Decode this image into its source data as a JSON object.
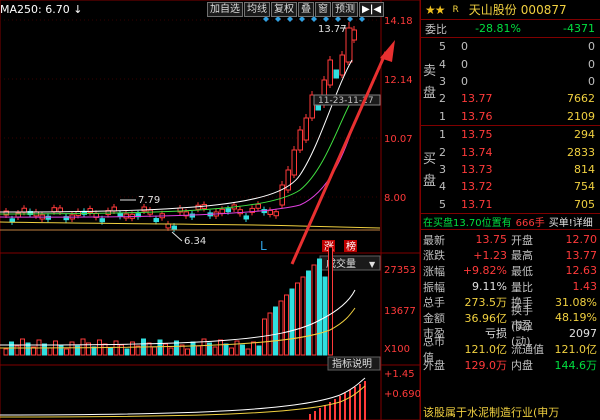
{
  "chart": {
    "ma_label": "MA250: 6.70",
    "ma_arrow": "↓",
    "toolbar": [
      "加自选",
      "均线",
      "复权",
      "叠",
      "窗",
      "预测"
    ],
    "toolbar_nav": "▶|◀",
    "price_ticks": [
      "14.18",
      "12.14",
      "10.07",
      "8.00"
    ],
    "high_label": "13.77",
    "low_label": "6.34",
    "mid_label": "7.79",
    "date_label": "11-23-11-27",
    "marker_L": "L",
    "badge_zhang": "涨",
    "badge_ting": "榜",
    "vol_button": "成交量",
    "vol_ticks": [
      "27353",
      "13677",
      "X100"
    ],
    "indicator_button": "指标说明",
    "macd_ticks": [
      "+1.45",
      "+0.690"
    ],
    "colors": {
      "up": "#ff3a3a",
      "down": "#30e0e0",
      "ma_white": "#ffffff",
      "ma_yellow": "#f0d040",
      "ma_magenta": "#e040e0",
      "ma_green": "#40e040",
      "axis": "#800000"
    }
  },
  "quote": {
    "stars": "★★",
    "r_badge": "R",
    "name": "天山股份",
    "code": "000877",
    "weibi_label": "委比",
    "weibi_pct": "-28.81%",
    "weibi_diff": "-4371",
    "sell_label": [
      "卖",
      "盘"
    ],
    "buy_label": [
      "买",
      "盘"
    ],
    "sell": [
      {
        "idx": "5",
        "price": "0",
        "qty": "0"
      },
      {
        "idx": "4",
        "price": "0",
        "qty": "0"
      },
      {
        "idx": "3",
        "price": "0",
        "qty": "0"
      },
      {
        "idx": "2",
        "price": "13.77",
        "qty": "7662"
      },
      {
        "idx": "1",
        "price": "13.76",
        "qty": "2109"
      }
    ],
    "buy": [
      {
        "idx": "1",
        "price": "13.75",
        "qty": "294"
      },
      {
        "idx": "2",
        "price": "13.74",
        "qty": "2833"
      },
      {
        "idx": "3",
        "price": "13.73",
        "qty": "814"
      },
      {
        "idx": "4",
        "price": "13.72",
        "qty": "754"
      },
      {
        "idx": "5",
        "price": "13.71",
        "qty": "705"
      }
    ],
    "summary_a": "在买盘13.70位置有",
    "summary_b": "666手",
    "summary_c": "买单!详细",
    "stats": [
      {
        "k": "最新",
        "v": "13.75",
        "vc": "red",
        "k2": "开盘",
        "v2": "12.70",
        "v2c": "red"
      },
      {
        "k": "涨跌",
        "v": "+1.23",
        "vc": "red",
        "k2": "最高",
        "v2": "13.77",
        "v2c": "red"
      },
      {
        "k": "涨幅",
        "v": "+9.82%",
        "vc": "red",
        "k2": "最低",
        "v2": "12.63",
        "v2c": "red"
      },
      {
        "k": "振幅",
        "v": "9.11%",
        "vc": "white",
        "k2": "量比",
        "v2": "1.43",
        "v2c": "red"
      },
      {
        "k": "总手",
        "v": "273.5万",
        "vc": "yellow",
        "k2": "换手",
        "v2": "31.08%",
        "v2c": "yellow"
      },
      {
        "k": "金额",
        "v": "36.96亿",
        "vc": "yellow",
        "k2": "换手(实)",
        "v2": "48.19%",
        "v2c": "yellow"
      },
      {
        "k": "市盈",
        "v": "亏损",
        "vc": "white",
        "k2": "市盈(动)",
        "v2": "2097",
        "v2c": "white"
      },
      {
        "k": "总市值",
        "v": "121.0亿",
        "vc": "yellow",
        "k2": "流通值",
        "v2": "121.0亿",
        "v2c": "yellow"
      },
      {
        "k": "外盘",
        "v": "129.0万",
        "vc": "red",
        "k2": "内盘",
        "v2": "144.6万",
        "v2c": "green"
      }
    ],
    "footer": "该股属于水泥制造行业(申万"
  }
}
